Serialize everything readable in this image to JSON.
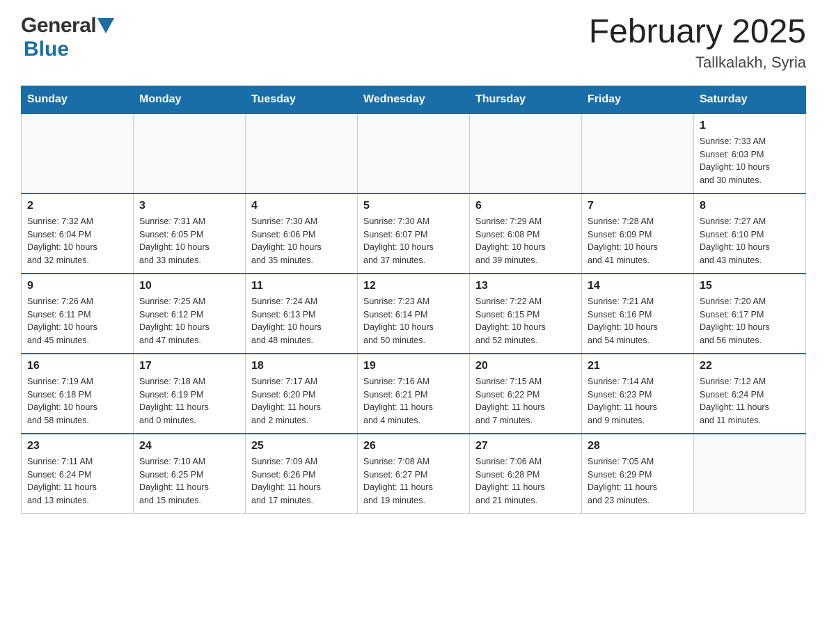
{
  "header": {
    "title": "February 2025",
    "subtitle": "Tallkalakh, Syria"
  },
  "logo": {
    "general": "General",
    "blue": "Blue"
  },
  "days_of_week": [
    "Sunday",
    "Monday",
    "Tuesday",
    "Wednesday",
    "Thursday",
    "Friday",
    "Saturday"
  ],
  "weeks": [
    {
      "days": [
        {
          "number": "",
          "info": ""
        },
        {
          "number": "",
          "info": ""
        },
        {
          "number": "",
          "info": ""
        },
        {
          "number": "",
          "info": ""
        },
        {
          "number": "",
          "info": ""
        },
        {
          "number": "",
          "info": ""
        },
        {
          "number": "1",
          "info": "Sunrise: 7:33 AM\nSunset: 6:03 PM\nDaylight: 10 hours\nand 30 minutes."
        }
      ]
    },
    {
      "days": [
        {
          "number": "2",
          "info": "Sunrise: 7:32 AM\nSunset: 6:04 PM\nDaylight: 10 hours\nand 32 minutes."
        },
        {
          "number": "3",
          "info": "Sunrise: 7:31 AM\nSunset: 6:05 PM\nDaylight: 10 hours\nand 33 minutes."
        },
        {
          "number": "4",
          "info": "Sunrise: 7:30 AM\nSunset: 6:06 PM\nDaylight: 10 hours\nand 35 minutes."
        },
        {
          "number": "5",
          "info": "Sunrise: 7:30 AM\nSunset: 6:07 PM\nDaylight: 10 hours\nand 37 minutes."
        },
        {
          "number": "6",
          "info": "Sunrise: 7:29 AM\nSunset: 6:08 PM\nDaylight: 10 hours\nand 39 minutes."
        },
        {
          "number": "7",
          "info": "Sunrise: 7:28 AM\nSunset: 6:09 PM\nDaylight: 10 hours\nand 41 minutes."
        },
        {
          "number": "8",
          "info": "Sunrise: 7:27 AM\nSunset: 6:10 PM\nDaylight: 10 hours\nand 43 minutes."
        }
      ]
    },
    {
      "days": [
        {
          "number": "9",
          "info": "Sunrise: 7:26 AM\nSunset: 6:11 PM\nDaylight: 10 hours\nand 45 minutes."
        },
        {
          "number": "10",
          "info": "Sunrise: 7:25 AM\nSunset: 6:12 PM\nDaylight: 10 hours\nand 47 minutes."
        },
        {
          "number": "11",
          "info": "Sunrise: 7:24 AM\nSunset: 6:13 PM\nDaylight: 10 hours\nand 48 minutes."
        },
        {
          "number": "12",
          "info": "Sunrise: 7:23 AM\nSunset: 6:14 PM\nDaylight: 10 hours\nand 50 minutes."
        },
        {
          "number": "13",
          "info": "Sunrise: 7:22 AM\nSunset: 6:15 PM\nDaylight: 10 hours\nand 52 minutes."
        },
        {
          "number": "14",
          "info": "Sunrise: 7:21 AM\nSunset: 6:16 PM\nDaylight: 10 hours\nand 54 minutes."
        },
        {
          "number": "15",
          "info": "Sunrise: 7:20 AM\nSunset: 6:17 PM\nDaylight: 10 hours\nand 56 minutes."
        }
      ]
    },
    {
      "days": [
        {
          "number": "16",
          "info": "Sunrise: 7:19 AM\nSunset: 6:18 PM\nDaylight: 10 hours\nand 58 minutes."
        },
        {
          "number": "17",
          "info": "Sunrise: 7:18 AM\nSunset: 6:19 PM\nDaylight: 11 hours\nand 0 minutes."
        },
        {
          "number": "18",
          "info": "Sunrise: 7:17 AM\nSunset: 6:20 PM\nDaylight: 11 hours\nand 2 minutes."
        },
        {
          "number": "19",
          "info": "Sunrise: 7:16 AM\nSunset: 6:21 PM\nDaylight: 11 hours\nand 4 minutes."
        },
        {
          "number": "20",
          "info": "Sunrise: 7:15 AM\nSunset: 6:22 PM\nDaylight: 11 hours\nand 7 minutes."
        },
        {
          "number": "21",
          "info": "Sunrise: 7:14 AM\nSunset: 6:23 PM\nDaylight: 11 hours\nand 9 minutes."
        },
        {
          "number": "22",
          "info": "Sunrise: 7:12 AM\nSunset: 6:24 PM\nDaylight: 11 hours\nand 11 minutes."
        }
      ]
    },
    {
      "days": [
        {
          "number": "23",
          "info": "Sunrise: 7:11 AM\nSunset: 6:24 PM\nDaylight: 11 hours\nand 13 minutes."
        },
        {
          "number": "24",
          "info": "Sunrise: 7:10 AM\nSunset: 6:25 PM\nDaylight: 11 hours\nand 15 minutes."
        },
        {
          "number": "25",
          "info": "Sunrise: 7:09 AM\nSunset: 6:26 PM\nDaylight: 11 hours\nand 17 minutes."
        },
        {
          "number": "26",
          "info": "Sunrise: 7:08 AM\nSunset: 6:27 PM\nDaylight: 11 hours\nand 19 minutes."
        },
        {
          "number": "27",
          "info": "Sunrise: 7:06 AM\nSunset: 6:28 PM\nDaylight: 11 hours\nand 21 minutes."
        },
        {
          "number": "28",
          "info": "Sunrise: 7:05 AM\nSunset: 6:29 PM\nDaylight: 11 hours\nand 23 minutes."
        },
        {
          "number": "",
          "info": ""
        }
      ]
    }
  ]
}
